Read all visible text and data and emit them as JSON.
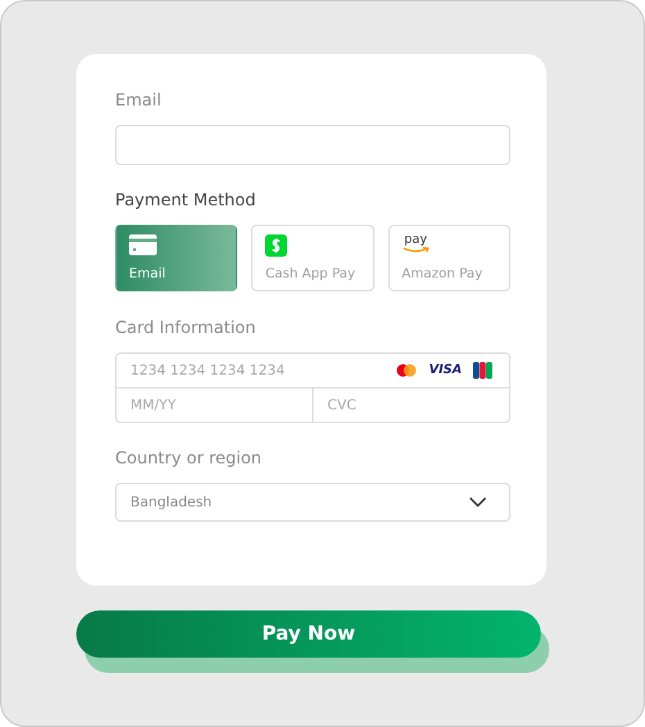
{
  "email": {
    "label": "Email"
  },
  "payment_method": {
    "label": "Payment Method",
    "options": [
      {
        "kind": "card",
        "label": "Email",
        "selected": true
      },
      {
        "kind": "cashapp",
        "label": "Cash App Pay",
        "selected": false
      },
      {
        "kind": "amazon",
        "label": "Amazon Pay",
        "selected": false,
        "logo_text": "pay"
      }
    ]
  },
  "card_information": {
    "label": "Card Information",
    "number_placeholder": "1234 1234 1234 1234",
    "brand_text": "VISA",
    "expiry_placeholder": "MM/YY",
    "cvc_placeholder": "CVC"
  },
  "country": {
    "label": "Country or region",
    "value": "Bangladesh"
  },
  "pay_button": "Pay Now"
}
